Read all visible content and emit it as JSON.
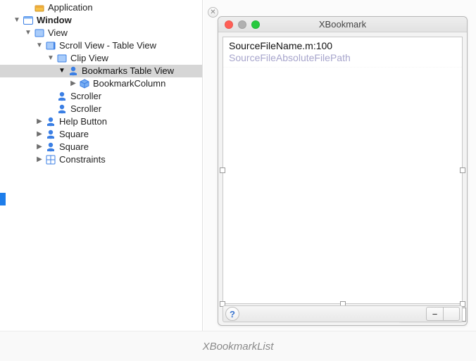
{
  "outline": {
    "items": [
      {
        "depth": 2,
        "expand": "",
        "icon": "application",
        "label": "Application",
        "bold": false,
        "selected": false
      },
      {
        "depth": 1,
        "expand": "down",
        "icon": "window",
        "label": "Window",
        "bold": true,
        "selected": false
      },
      {
        "depth": 2,
        "expand": "down",
        "icon": "view",
        "label": "View",
        "bold": false,
        "selected": false
      },
      {
        "depth": 3,
        "expand": "down",
        "icon": "scroll",
        "label": "Scroll View - Table View",
        "bold": false,
        "selected": false
      },
      {
        "depth": 4,
        "expand": "down",
        "icon": "view",
        "label": "Clip View",
        "bold": false,
        "selected": false
      },
      {
        "depth": 5,
        "expand": "down",
        "icon": "table",
        "label": "Bookmarks Table View",
        "bold": false,
        "selected": true
      },
      {
        "depth": 6,
        "expand": "right",
        "icon": "cube",
        "label": "BookmarkColumn",
        "bold": false,
        "selected": false
      },
      {
        "depth": 4,
        "expand": "",
        "icon": "scroller",
        "label": "Scroller",
        "bold": false,
        "selected": false
      },
      {
        "depth": 4,
        "expand": "",
        "icon": "scroller",
        "label": "Scroller",
        "bold": false,
        "selected": false
      },
      {
        "depth": 3,
        "expand": "right",
        "icon": "scroller",
        "label": "Help Button",
        "bold": false,
        "selected": false
      },
      {
        "depth": 3,
        "expand": "right",
        "icon": "scroller",
        "label": "Square",
        "bold": false,
        "selected": false
      },
      {
        "depth": 3,
        "expand": "right",
        "icon": "scroller",
        "label": "Square",
        "bold": false,
        "selected": false
      },
      {
        "depth": 3,
        "expand": "right",
        "icon": "constraints",
        "label": "Constraints",
        "bold": false,
        "selected": false
      }
    ]
  },
  "preview": {
    "window_title": "XBookmark",
    "row": {
      "source_name": "SourceFileName.m:100",
      "source_path": "SourceFileAbsoluteFilePath"
    },
    "help_glyph": "?",
    "minus_glyph": "−",
    "selection_tag": "XBookmarkList"
  },
  "caption": "XBookmarkList"
}
